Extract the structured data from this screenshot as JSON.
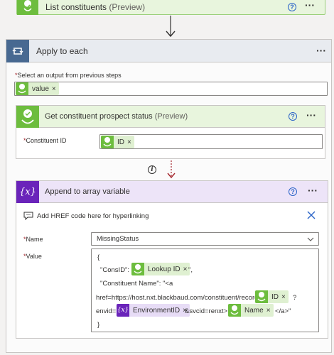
{
  "top_card": {
    "title": "List constituents",
    "preview": "(Preview)",
    "help": "?",
    "more": "···"
  },
  "apply": {
    "title": "Apply to each",
    "more": "···",
    "select_label": "Select an output from previous steps",
    "select_token": "value",
    "token_remove": "×"
  },
  "prospect_card": {
    "title": "Get constituent prospect status",
    "preview": "(Preview)",
    "help": "?",
    "more": "···",
    "field_label": "Constituent ID",
    "token": "ID",
    "token_remove": "×"
  },
  "connector": {
    "info": "i"
  },
  "append_card": {
    "title": "Append to array variable",
    "help": "?",
    "more": "···",
    "note": "Add HREF code here for hyperlinking",
    "name_label": "Name",
    "name_value": "MissingStatus",
    "value_label": "Value",
    "value": {
      "open_brace": "{",
      "line1_prefix": "\"ConsID\": \"",
      "line1_token": "Lookup ID",
      "line1_suffix": "\",",
      "line2": "\"Constituent Name\": \"<a",
      "line3_prefix": "href=https://host.nxt.blackbaud.com/constituent/records/",
      "line3_token": "ID",
      "line3_suffix": "?",
      "line4_prefix": "envid=",
      "line4_token1": "EnvironmentID",
      "line4_mid": "&svcid=renxt>",
      "line4_token2": "Name",
      "line4_suffix": "</a>\"",
      "close_brace": "}",
      "token_remove": "×",
      "var_icon": "{x}"
    }
  },
  "colors": {
    "green": "#6dbd3e",
    "purple": "#6a24ba",
    "navy": "#486991",
    "required": "#a4262c"
  }
}
